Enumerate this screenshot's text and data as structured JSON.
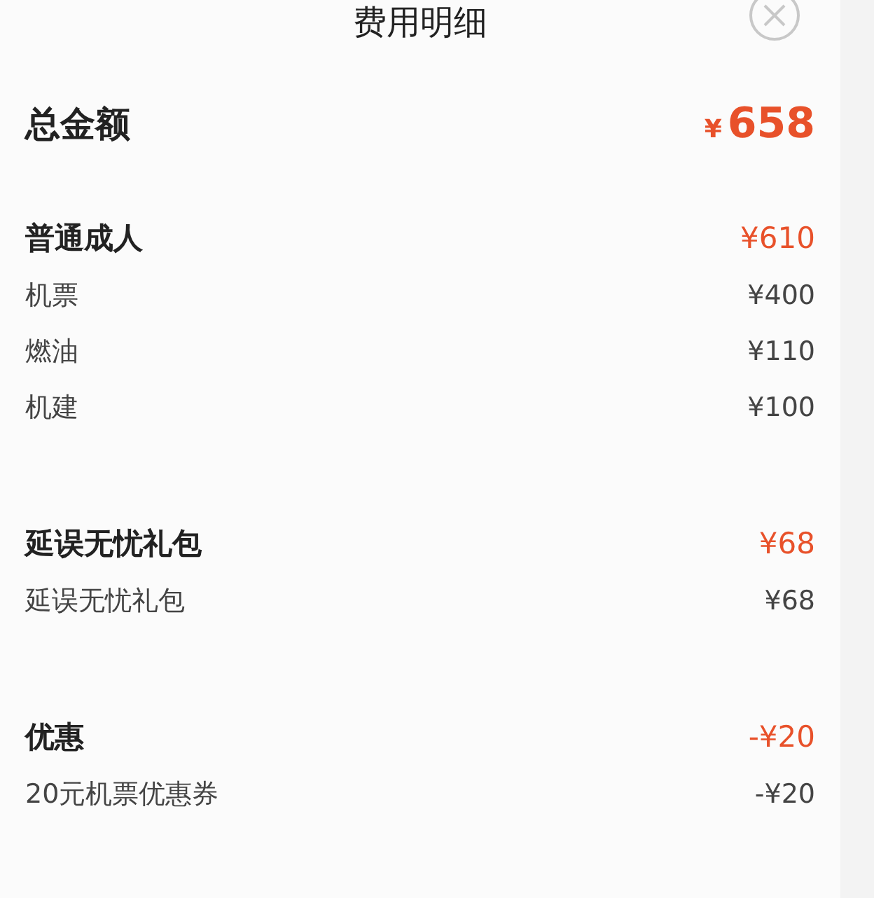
{
  "title": "费用明细",
  "total": {
    "label": "总金额",
    "currency": "¥",
    "amount": "658"
  },
  "sections": [
    {
      "name": "普通成人",
      "amount": "¥610",
      "items": [
        {
          "name": "机票",
          "amount": "¥400"
        },
        {
          "name": "燃油",
          "amount": "¥110"
        },
        {
          "name": "机建",
          "amount": "¥100"
        }
      ]
    },
    {
      "name": "延误无忧礼包",
      "amount": "¥68",
      "items": [
        {
          "name": "延误无忧礼包",
          "amount": "¥68"
        }
      ]
    },
    {
      "name": "优惠",
      "amount": "-¥20",
      "items": [
        {
          "name": "20元机票优惠券",
          "amount": "-¥20"
        }
      ]
    }
  ]
}
